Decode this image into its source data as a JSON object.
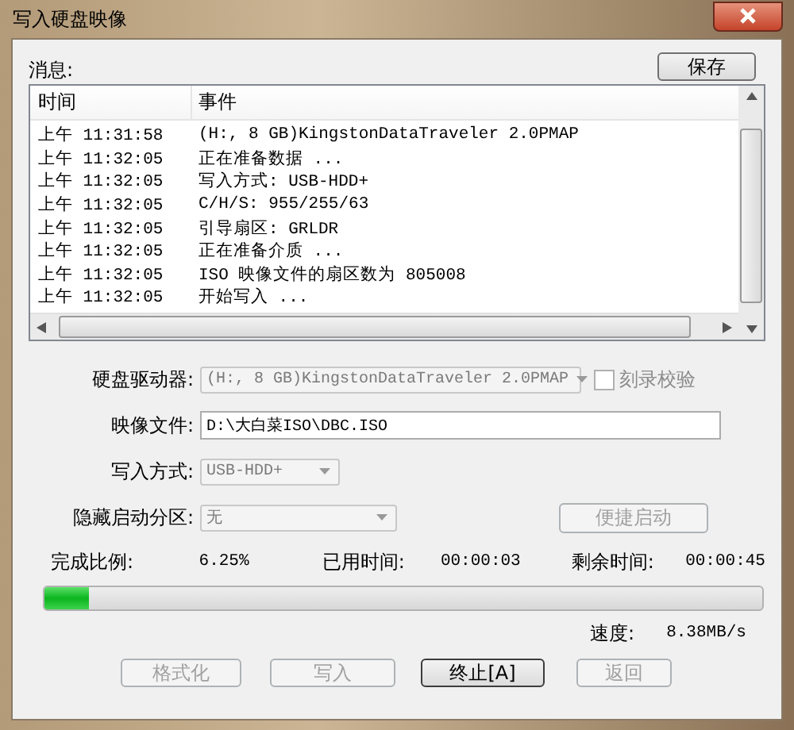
{
  "window": {
    "title": "写入硬盘映像"
  },
  "messages": {
    "label": "消息:",
    "save_button": "保存",
    "columns": [
      "时间",
      "事件"
    ],
    "rows": [
      {
        "time": "上午 11:31:58",
        "event": "(H:, 8 GB)KingstonDataTraveler 2.0PMAP"
      },
      {
        "time": "上午 11:32:05",
        "event": "正在准备数据 ..."
      },
      {
        "time": "上午 11:32:05",
        "event": "写入方式: USB-HDD+"
      },
      {
        "time": "上午 11:32:05",
        "event": "C/H/S: 955/255/63"
      },
      {
        "time": "上午 11:32:05",
        "event": "引导扇区: GRLDR"
      },
      {
        "time": "上午 11:32:05",
        "event": "正在准备介质 ..."
      },
      {
        "time": "上午 11:32:05",
        "event": "ISO 映像文件的扇区数为 805008"
      },
      {
        "time": "上午 11:32:05",
        "event": "开始写入 ..."
      }
    ]
  },
  "form": {
    "drive": {
      "label": "硬盘驱动器:",
      "value": "(H:, 8 GB)KingstonDataTraveler 2.0PMAP",
      "disabled": true
    },
    "verify": {
      "label": "刻录校验",
      "checked": false,
      "disabled": true
    },
    "image_file": {
      "label": "映像文件:",
      "value": "D:\\大白菜ISO\\DBC.ISO"
    },
    "write_mode": {
      "label": "写入方式:",
      "value": "USB-HDD+",
      "disabled": true
    },
    "hidden_partition": {
      "label": "隐藏启动分区:",
      "value": "无",
      "disabled": true
    },
    "quick_boot": {
      "label": "便捷启动",
      "disabled": true
    }
  },
  "progress": {
    "percent_label": "完成比例:",
    "percent": "6.25%",
    "elapsed_label": "已用时间:",
    "elapsed": "00:00:03",
    "remaining_label": "剩余时间:",
    "remaining": "00:00:45",
    "level": 0.0625,
    "speed_label": "速度:",
    "speed": "8.38MB/s"
  },
  "buttons": [
    {
      "label": "格式化",
      "disabled": true
    },
    {
      "label": "写入",
      "disabled": true
    },
    {
      "label": "终止[A]",
      "disabled": false
    },
    {
      "label": "返回",
      "disabled": true
    }
  ]
}
